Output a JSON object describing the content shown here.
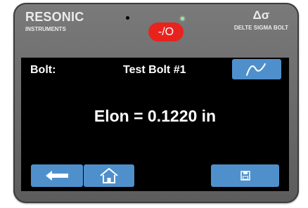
{
  "brand": {
    "name": "RESONIC",
    "subtitle": "INSTRUMENTS",
    "right_symbol": "Δσ",
    "right_subtitle": "DELTE SIGMA BOLT"
  },
  "power_button": {
    "label": "-/O"
  },
  "screen": {
    "bolt_label": "Bolt:",
    "bolt_name": "Test Bolt  #1",
    "measurement": "Elon = 0.1220 in"
  },
  "icons": {
    "waveform": "waveform-icon",
    "back": "arrow-left-icon",
    "home": "home-icon",
    "save": "floppy-disk-icon"
  },
  "colors": {
    "button_blue": "#4f90cc",
    "power_red": "#e8231e",
    "status_led": "#9be59b",
    "bezel": "#6b6b6b"
  }
}
